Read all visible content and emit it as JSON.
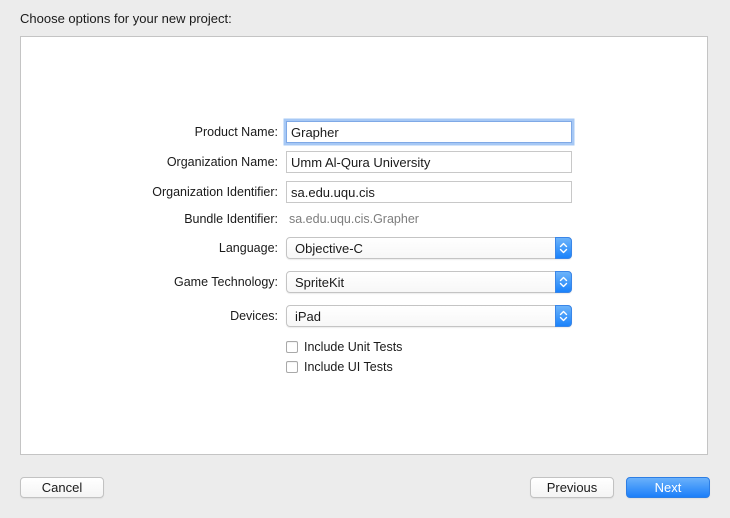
{
  "sheet": {
    "title": "Choose options for your new project:"
  },
  "form": {
    "product_name": {
      "label": "Product Name:",
      "value": "Grapher"
    },
    "organization_name": {
      "label": "Organization Name:",
      "value": "Umm Al-Qura University"
    },
    "organization_identifier": {
      "label": "Organization Identifier:",
      "value": "sa.edu.uqu.cis"
    },
    "bundle_identifier": {
      "label": "Bundle Identifier:",
      "value": "sa.edu.uqu.cis.Grapher"
    },
    "language": {
      "label": "Language:",
      "value": "Objective-C"
    },
    "game_technology": {
      "label": "Game Technology:",
      "value": "SpriteKit"
    },
    "devices": {
      "label": "Devices:",
      "value": "iPad"
    },
    "include_unit_tests": {
      "label": "Include Unit Tests",
      "checked": false
    },
    "include_ui_tests": {
      "label": "Include UI Tests",
      "checked": false
    }
  },
  "footer": {
    "cancel_label": "Cancel",
    "previous_label": "Previous",
    "next_label": "Next"
  },
  "colors": {
    "accent": "#1b7ef9",
    "focus_ring": "#a6c8f5",
    "window_bg": "#ececec",
    "panel_bg": "#ffffff",
    "secondary_text": "#7d7d7d"
  },
  "icons": {
    "popup_indicator": "up-down-chevron-icon"
  }
}
